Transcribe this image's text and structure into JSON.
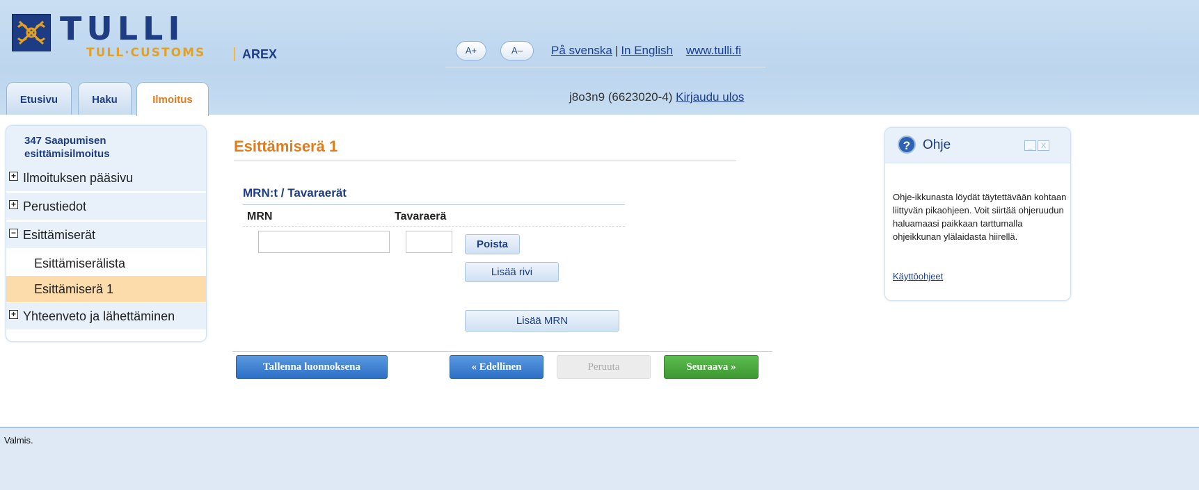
{
  "header": {
    "logo_title": "TULLI",
    "logo_subtitle": "TULL·CUSTOMS",
    "app_name": "AREX",
    "font_increase": "A+",
    "font_decrease": "A–",
    "lang_swedish": "På svenska",
    "lang_sep": "|",
    "lang_english": "In English",
    "site_link": "www.tulli.fi"
  },
  "tabs": [
    {
      "label": "Etusivu"
    },
    {
      "label": "Haku"
    },
    {
      "label": "Ilmoitus",
      "active": true
    }
  ],
  "user": {
    "info": "j8o3n9 (6623020-4)",
    "logout": "Kirjaudu ulos"
  },
  "sidebar": {
    "title_line1": "347 Saapumisen",
    "title_line2": "esittämisilmoitus",
    "items": [
      {
        "label": "Ilmoituksen pääsivu",
        "icon": "plus"
      },
      {
        "label": "Perustiedot",
        "icon": "plus"
      },
      {
        "label": "Esittämiserät",
        "icon": "minus"
      },
      {
        "label": "Esittämiserälista"
      },
      {
        "label": "Esittämiserä 1",
        "active": true
      },
      {
        "label": "Yhteenveto ja lähettäminen",
        "icon": "plus"
      }
    ]
  },
  "main": {
    "title": "Esittämiserä 1",
    "section_title": "MRN:t / Tavaraerät",
    "col_mrn": "MRN",
    "col_tavaraera": "Tavaraerä",
    "mrn_value": "",
    "tavaraera_value": "",
    "delete_btn": "Poista",
    "add_row_btn": "Lisää rivi",
    "add_mrn_btn": "Lisää MRN"
  },
  "actions": {
    "save_draft": "Tallenna luonnoksena",
    "previous": "« Edellinen",
    "cancel": "Peruuta",
    "next": "Seuraava »"
  },
  "help": {
    "title": "Ohje",
    "text": "Ohje-ikkunasta löydät täytettävään kohtaan liittyvän pikaohjeen. Voit siirtää ohjeruudun haluamaasi paikkaan tarttumalla ohjeikkunan ylälaidasta hiirellä.",
    "link": "Käyttöohjeet",
    "minimize": "_",
    "close": "X"
  },
  "status": {
    "text": "Valmis."
  },
  "colors": {
    "brand_blue": "#1d3c84",
    "accent_orange": "#e07b1e",
    "next_green": "#3e9832"
  }
}
